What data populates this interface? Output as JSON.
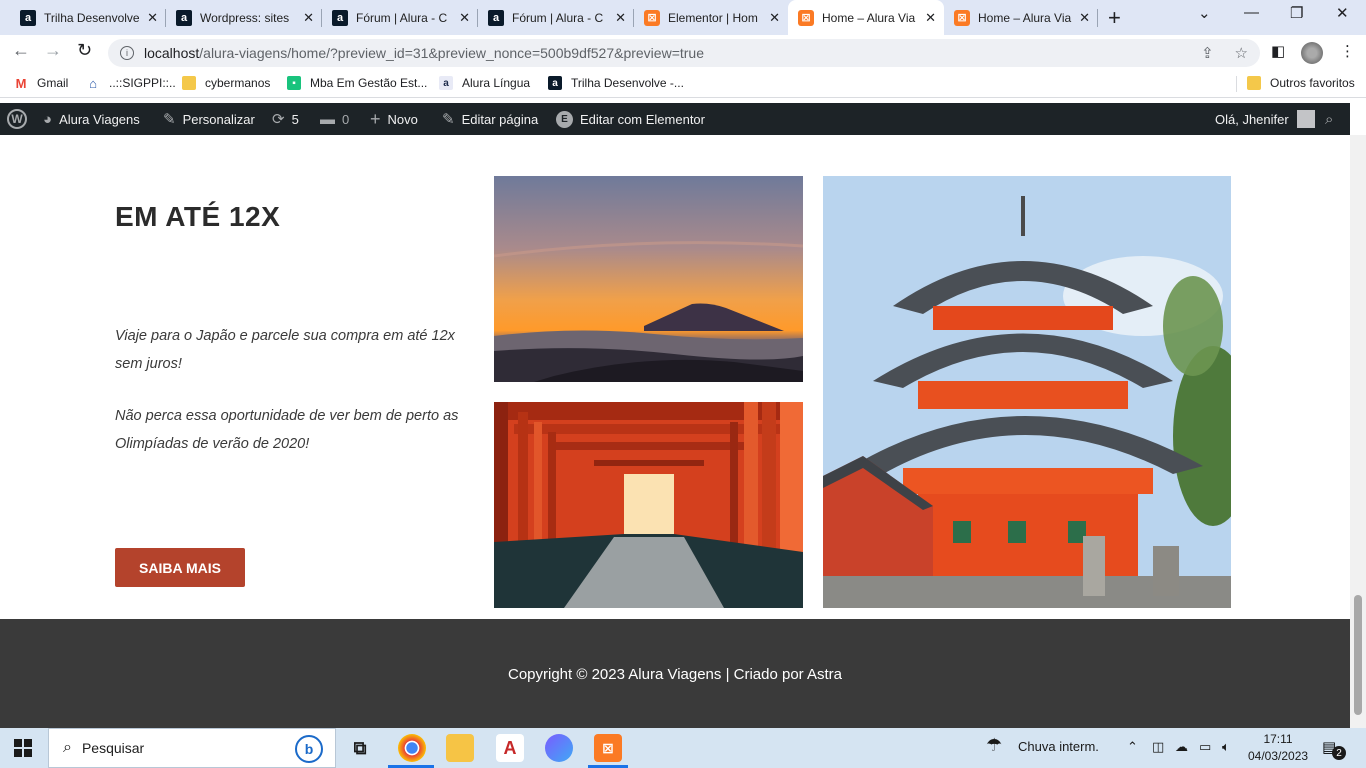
{
  "browser": {
    "tabs": [
      {
        "title": "Trilha Desenvolve",
        "favicon": "alura-icon",
        "active": false
      },
      {
        "title": "Wordpress: sites",
        "favicon": "alura-icon",
        "active": false
      },
      {
        "title": "Fórum | Alura - C",
        "favicon": "alura-icon",
        "active": false
      },
      {
        "title": "Fórum | Alura - C",
        "favicon": "alura-icon",
        "active": false
      },
      {
        "title": "Elementor | Hom",
        "favicon": "xampp-icon",
        "active": false
      },
      {
        "title": "Home – Alura Via",
        "favicon": "xampp-icon",
        "active": true
      },
      {
        "title": "Home – Alura Via",
        "favicon": "xampp-icon",
        "active": false
      }
    ],
    "url_host": "localhost",
    "url_path": "/alura-viagens/home/?preview_id=31&preview_nonce=500b9df527&preview=true",
    "bookmarks": [
      {
        "label": "Gmail",
        "icon": "gmail-icon"
      },
      {
        "label": "..::SIGPPI::..",
        "icon": "sigppi-icon"
      },
      {
        "label": "cybermanos",
        "icon": "folder-icon"
      },
      {
        "label": "Mba Em Gestão Est...",
        "icon": "mba-icon"
      },
      {
        "label": "Alura Língua",
        "icon": "alura-icon"
      },
      {
        "label": "Trilha Desenvolve -...",
        "icon": "alura-icon"
      }
    ],
    "other_bookmarks": "Outros favoritos"
  },
  "admin_bar": {
    "site_name": "Alura Viagens",
    "customize": "Personalizar",
    "updates_count": "5",
    "comments_count": "0",
    "new_label": "Novo",
    "edit_page": "Editar página",
    "edit_elementor": "Editar com Elementor",
    "greeting": "Olá, Jhenifer"
  },
  "page": {
    "heading": "EM ATÉ 12X",
    "paragraph_1": "Viaje para o Japão e parcele sua compra em até 12x sem juros!",
    "paragraph_2": "Não perca essa oportunidade de ver bem de perto as Olimpíadas de verão de 2020!",
    "cta_label": "SAIBA MAIS",
    "footer_text": "Copyright © 2023 Alura Viagens | Criado por Astra"
  },
  "taskbar": {
    "search_placeholder": "Pesquisar",
    "weather": "Chuva interm.",
    "time": "17:11",
    "date": "04/03/2023",
    "notifications": "2"
  },
  "colors": {
    "cta": "#b4432c",
    "admin_bar": "#1d2327",
    "footer": "#3a3a3a"
  }
}
